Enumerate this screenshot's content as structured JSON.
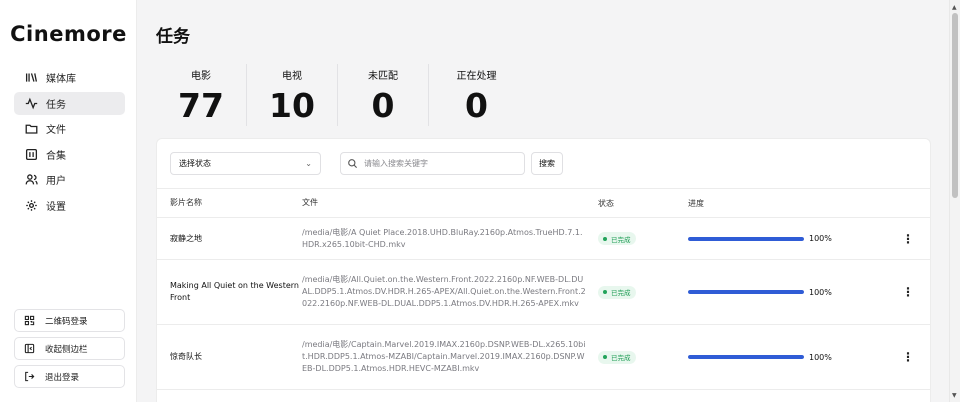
{
  "app": {
    "brand": "Cinemore"
  },
  "sidebar": {
    "items": [
      {
        "label": "媒体库",
        "icon": "library-icon",
        "active": false
      },
      {
        "label": "任务",
        "icon": "activity-icon",
        "active": true
      },
      {
        "label": "文件",
        "icon": "folder-icon",
        "active": false
      },
      {
        "label": "合集",
        "icon": "collection-icon",
        "active": false
      },
      {
        "label": "用户",
        "icon": "users-icon",
        "active": false
      },
      {
        "label": "设置",
        "icon": "gear-icon",
        "active": false
      }
    ],
    "bottom": [
      {
        "label": "二维码登录",
        "icon": "qrcode-icon"
      },
      {
        "label": "收起侧边栏",
        "icon": "sidebar-collapse-icon"
      },
      {
        "label": "退出登录",
        "icon": "logout-icon"
      }
    ]
  },
  "main": {
    "title": "任务",
    "stats": [
      {
        "label": "电影",
        "value": "77"
      },
      {
        "label": "电视",
        "value": "10"
      },
      {
        "label": "未匹配",
        "value": "0"
      },
      {
        "label": "正在处理",
        "value": "0"
      }
    ],
    "filters": {
      "status_placeholder": "选择状态",
      "search_placeholder": "请输入搜索关键字",
      "search_button": "搜索"
    },
    "table": {
      "columns": [
        "影片名称",
        "文件",
        "状态",
        "进度"
      ],
      "rows": [
        {
          "name": "寂静之地",
          "file": "/media/电影/A Quiet Place.2018.UHD.BluRay.2160p.Atmos.TrueHD.7.1.HDR.x265.10bit-CHD.mkv",
          "status": "已完成",
          "progress": 100,
          "progress_text": "100%"
        },
        {
          "name": "Making All Quiet on the Western Front",
          "file": "/media/电影/All.Quiet.on.the.Western.Front.2022.2160p.NF.WEB-DL.DUAL.DDP5.1.Atmos.DV.HDR.H.265-APEX/All.Quiet.on.the.Western.Front.2022.2160p.NF.WEB-DL.DUAL.DDP5.1.Atmos.DV.HDR.H.265-APEX.mkv",
          "status": "已完成",
          "progress": 100,
          "progress_text": "100%"
        },
        {
          "name": "惊奇队长",
          "file": "/media/电影/Captain.Marvel.2019.IMAX.2160p.DSNP.WEB-DL.x265.10bit.HDR.DDP5.1.Atmos-MZABI/Captain.Marvel.2019.IMAX.2160p.DSNP.WEB-DL.DDP5.1.Atmos.HDR.HEVC-MZABI.mkv",
          "status": "已完成",
          "progress": 100,
          "progress_text": "100%"
        }
      ]
    }
  },
  "colors": {
    "accent": "#2f5cd6",
    "success_text": "#1f9d55",
    "success_bg": "#e8f7ee"
  }
}
